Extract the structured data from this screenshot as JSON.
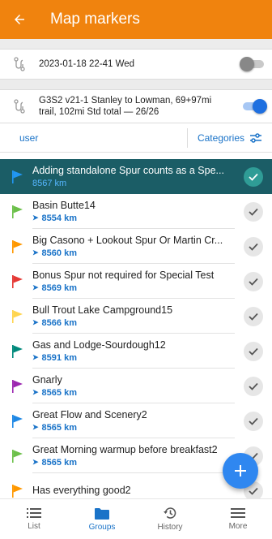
{
  "app_bar": {
    "title": "Map markers",
    "back_icon": "arrow-left-icon"
  },
  "tracks": [
    {
      "label": "2023-01-18 22-41 Wed",
      "enabled": false
    },
    {
      "label": "G3S2 v21-1 Stanley to Lowman, 69+97mi trail, 102mi Std total — 26/26",
      "enabled": true
    }
  ],
  "filter_bar": {
    "user_label": "user",
    "categories_label": "Categories"
  },
  "markers": [
    {
      "name": "Adding standalone Spur counts as a Spe...",
      "distance": "8567 km",
      "flag_color": "#2196f3",
      "selected": true
    },
    {
      "name": "Basin Butte14",
      "distance": "8554 km",
      "flag_color": "#6cc04a",
      "selected": false
    },
    {
      "name": "Big Casono + Lookout Spur  Or Martin Cr...",
      "distance": "8560 km",
      "flag_color": "#ff9800",
      "selected": false
    },
    {
      "name": "Bonus Spur not required for Special Test",
      "distance": "8569 km",
      "flag_color": "#e53935",
      "selected": false
    },
    {
      "name": "Bull Trout Lake Campground15",
      "distance": "8566 km",
      "flag_color": "#ffd54f",
      "selected": false
    },
    {
      "name": "Gas and Lodge-Sourdough12",
      "distance": "8591 km",
      "flag_color": "#00897b",
      "selected": false
    },
    {
      "name": "Gnarly",
      "distance": "8565 km",
      "flag_color": "#9c27b0",
      "selected": false
    },
    {
      "name": "Great Flow and Scenery2",
      "distance": "8565 km",
      "flag_color": "#1e88e5",
      "selected": false
    },
    {
      "name": "Great Morning warmup before breakfast2",
      "distance": "8565 km",
      "flag_color": "#6cc04a",
      "selected": false
    },
    {
      "name": "Has everything good2",
      "distance": "",
      "flag_color": "#ff9800",
      "selected": false
    }
  ],
  "fab": {
    "icon": "plus-icon"
  },
  "bottom_nav": [
    {
      "label": "List",
      "icon": "list-icon",
      "active": false
    },
    {
      "label": "Groups",
      "icon": "folder-icon",
      "active": true
    },
    {
      "label": "History",
      "icon": "history-icon",
      "active": false
    },
    {
      "label": "More",
      "icon": "menu-icon",
      "active": false
    }
  ],
  "colors": {
    "accent": "#f0830e",
    "primary_blue": "#1a73c8",
    "selected_row": "#1b5d66"
  }
}
